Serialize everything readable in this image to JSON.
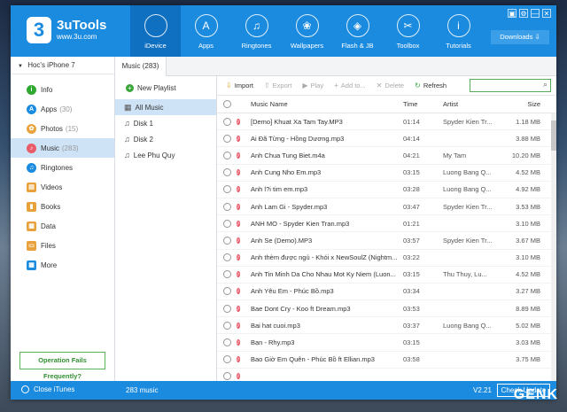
{
  "app": {
    "name": "3uTools",
    "url": "www.3u.com",
    "logo_char": "3"
  },
  "colors": {
    "topbar": "#1b8be0",
    "nav_active": "#0f6fc0",
    "selection": "#cfe3f7",
    "music_icon": "#ea5b6a",
    "green": "#3aa63a"
  },
  "window_controls": [
    "▣",
    "⚙",
    "—",
    "✕"
  ],
  "nav": [
    {
      "label": "iDevice",
      "icon": "apple-icon",
      "glyph": "",
      "active": true
    },
    {
      "label": "Apps",
      "icon": "apps-icon",
      "glyph": "A",
      "active": false
    },
    {
      "label": "Ringtones",
      "icon": "bell-icon",
      "glyph": "♫",
      "active": false
    },
    {
      "label": "Wallpapers",
      "icon": "flower-icon",
      "glyph": "❀",
      "active": false
    },
    {
      "label": "Flash & JB",
      "icon": "dropbox-icon",
      "glyph": "◈",
      "active": false
    },
    {
      "label": "Toolbox",
      "icon": "tools-icon",
      "glyph": "✂",
      "active": false
    },
    {
      "label": "Tutorials",
      "icon": "info-icon",
      "glyph": "i",
      "active": false
    }
  ],
  "downloads_label": "Downloads",
  "device_name": "Hoc's iPhone 7",
  "sidebar": [
    {
      "label": "Info",
      "count": "",
      "icon": "info-icon",
      "color": "#2fa82f",
      "glyph": "i",
      "active": false
    },
    {
      "label": "Apps",
      "count": "(30)",
      "icon": "apps-icon",
      "color": "#1b8be0",
      "glyph": "A",
      "active": false
    },
    {
      "label": "Photos",
      "count": "(15)",
      "icon": "photos-icon",
      "color": "#e9a23b",
      "glyph": "✿",
      "active": false
    },
    {
      "label": "Music",
      "count": "(283)",
      "icon": "music-icon",
      "color": "#ea5b6a",
      "glyph": "♪",
      "active": true
    },
    {
      "label": "Ringtones",
      "count": "",
      "icon": "bell-icon",
      "color": "#1b8be0",
      "glyph": "♫",
      "active": false
    },
    {
      "label": "Videos",
      "count": "",
      "icon": "film-icon",
      "color": "#e9a23b",
      "glyph": "▤",
      "active": false
    },
    {
      "label": "Books",
      "count": "",
      "icon": "book-icon",
      "color": "#e9a23b",
      "glyph": "▮",
      "active": false
    },
    {
      "label": "Data",
      "count": "",
      "icon": "data-icon",
      "color": "#e9a23b",
      "glyph": "▦",
      "active": false
    },
    {
      "label": "Files",
      "count": "",
      "icon": "folder-icon",
      "color": "#e9a23b",
      "glyph": "▭",
      "active": false
    },
    {
      "label": "More",
      "count": "",
      "icon": "grid-icon",
      "color": "#1b8be0",
      "glyph": "▦",
      "active": false
    }
  ],
  "operation_fails": "Operation Fails Frequently?",
  "tab_label": "Music (283)",
  "new_playlist": "New Playlist",
  "playlists": [
    {
      "label": "All Music",
      "active": true
    },
    {
      "label": "Disk 1",
      "active": false
    },
    {
      "label": "Disk 2",
      "active": false
    },
    {
      "label": "Lee Phu Quy",
      "active": false
    }
  ],
  "toolbar": [
    {
      "label": "Import",
      "icon": "import-icon",
      "glyph": "⇩",
      "enabled": true
    },
    {
      "label": "Export",
      "icon": "export-icon",
      "glyph": "⇧",
      "enabled": false
    },
    {
      "label": "Play",
      "icon": "play-icon",
      "glyph": "▶",
      "enabled": false
    },
    {
      "label": "Add to...",
      "icon": "add-icon",
      "glyph": "+",
      "enabled": false
    },
    {
      "label": "Delete",
      "icon": "delete-icon",
      "glyph": "✕",
      "enabled": false
    },
    {
      "label": "Refresh",
      "icon": "refresh-icon",
      "glyph": "↻",
      "enabled": true
    }
  ],
  "search": {
    "value": "",
    "placeholder": ""
  },
  "table": {
    "headers": {
      "name": "Music Name",
      "time": "Time",
      "artist": "Artist",
      "size": "Size"
    },
    "rows": [
      {
        "name": "[Demo] Khuat Xa Tam Tay.MP3",
        "time": "01:14",
        "artist": "Spyder Kien Tr...",
        "size": "1.18 MB"
      },
      {
        "name": "Ai Đã Từng - Hồng Dương.mp3",
        "time": "04:14",
        "artist": "",
        "size": "3.88 MB"
      },
      {
        "name": "Anh Chua Tung Biet.m4a",
        "time": "04:21",
        "artist": "My Tam",
        "size": "10.20 MB"
      },
      {
        "name": "Anh Cung Nho Em.mp3",
        "time": "03:15",
        "artist": "Luong Bang Q...",
        "size": "4.52 MB"
      },
      {
        "name": "Anh l?i tim em.mp3",
        "time": "03:28",
        "artist": "Luong Bang Q...",
        "size": "4.92 MB"
      },
      {
        "name": "Anh Lam Gi - Spyder.mp3",
        "time": "03:47",
        "artist": "Spyder Kien Tr...",
        "size": "3.53 MB"
      },
      {
        "name": "ANH MO - Spyder Kien Tran.mp3",
        "time": "01:21",
        "artist": "",
        "size": "3.10 MB"
      },
      {
        "name": "Anh Se (Demo).MP3",
        "time": "03:57",
        "artist": "Spyder Kien Tr...",
        "size": "3.67 MB"
      },
      {
        "name": "Anh thèm được ngủ - Khói x NewSoulZ (Nightm...",
        "time": "03:22",
        "artist": "",
        "size": "3.10 MB"
      },
      {
        "name": "Anh Tin Minh Da Cho Nhau Mot Ky Niem (Luon...",
        "time": "03:15",
        "artist": "Thu Thuy, Lu...",
        "size": "4.52 MB"
      },
      {
        "name": "Anh Yêu Em - Phúc Bồ.mp3",
        "time": "03:34",
        "artist": "",
        "size": "3.27 MB"
      },
      {
        "name": "Bae Dont Cry - Koo ft Dream.mp3",
        "time": "03:53",
        "artist": "",
        "size": "8.89 MB"
      },
      {
        "name": "Bai hat cuoi.mp3",
        "time": "03:37",
        "artist": "Luong Bang Q...",
        "size": "5.02 MB"
      },
      {
        "name": "Bạn - Rhy.mp3",
        "time": "03:15",
        "artist": "",
        "size": "3.03 MB"
      },
      {
        "name": "Bao Giờ Em Quên - Phúc Bồ ft Ellian.mp3",
        "time": "03:58",
        "artist": "",
        "size": "3.75 MB"
      },
      {
        "name": "",
        "time": "",
        "artist": "",
        "size": ""
      }
    ]
  },
  "bottom": {
    "close_itunes": "Close iTunes",
    "count": "283 music",
    "version": "V2.21",
    "check_update": "Check Update"
  },
  "watermark": "GENK"
}
